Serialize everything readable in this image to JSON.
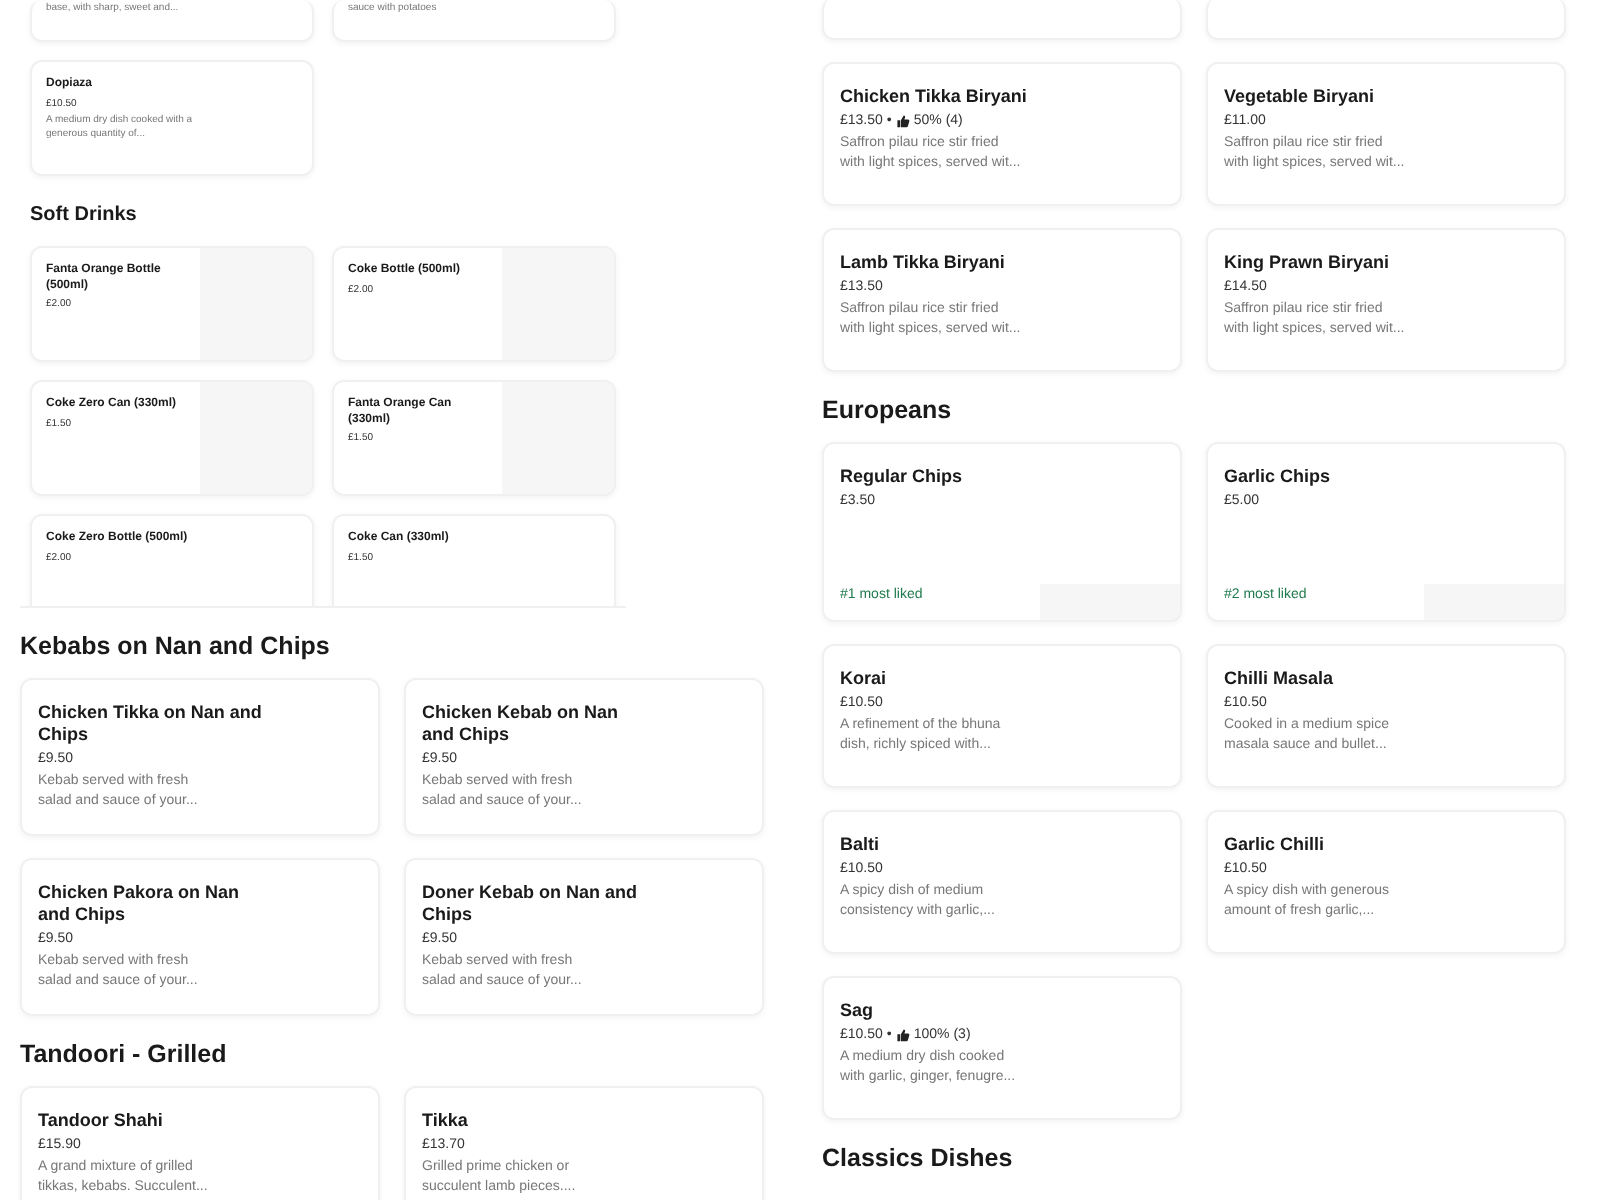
{
  "left": {
    "compact_sections": [
      {
        "items": [
          {
            "kind": "partial",
            "description": "base, with sharp, sweet and..."
          },
          {
            "kind": "partial",
            "description": "sauce with potatoes"
          },
          {
            "kind": "item",
            "name": "Dopiaza",
            "price": "£10.50",
            "description": "A medium dry dish cooked with a generous quantity of..."
          }
        ]
      },
      {
        "title": "Soft Drinks",
        "items": [
          {
            "kind": "item",
            "name": "Fanta Orange Bottle (500ml)",
            "price": "£2.00",
            "image": true
          },
          {
            "kind": "item",
            "name": "Coke Bottle (500ml)",
            "price": "£2.00",
            "image": true
          },
          {
            "kind": "item",
            "name": "Coke Zero Can (330ml)",
            "price": "£1.50",
            "image": true
          },
          {
            "kind": "item",
            "name": "Fanta Orange Can (330ml)",
            "price": "£1.50",
            "image": true
          },
          {
            "kind": "item",
            "name": "Coke Zero Bottle (500ml)",
            "price": "£2.00"
          },
          {
            "kind": "item",
            "name": "Coke Can (330ml)",
            "price": "£1.50"
          }
        ]
      }
    ],
    "sections": [
      {
        "title": "Kebabs on Nan and Chips",
        "items": [
          {
            "kind": "item",
            "name": "Chicken Tikka on Nan and Chips",
            "price": "£9.50",
            "description": "Kebab served with fresh salad and sauce of your..."
          },
          {
            "kind": "item",
            "name": "Chicken Kebab on Nan and Chips",
            "price": "£9.50",
            "description": "Kebab served with fresh salad and sauce of your..."
          },
          {
            "kind": "item",
            "name": "Chicken Pakora on Nan and Chips",
            "price": "£9.50",
            "description": "Kebab served with fresh salad and sauce of your..."
          },
          {
            "kind": "item",
            "name": "Doner Kebab on Nan and Chips",
            "price": "£9.50",
            "description": "Kebab served with fresh salad and sauce of your..."
          }
        ]
      },
      {
        "title": "Tandoori - Grilled",
        "items": [
          {
            "kind": "item",
            "name": "Tandoor Shahi",
            "price": "£15.90",
            "description": "A grand mixture of grilled tikkas, kebabs. Succulent..."
          },
          {
            "kind": "item",
            "name": "Tikka",
            "price": "£13.70",
            "description": "Grilled prime chicken or succulent lamb pieces...."
          }
        ]
      }
    ]
  },
  "right": {
    "sections": [
      {
        "items": [
          {
            "kind": "partial"
          },
          {
            "kind": "partial"
          },
          {
            "kind": "item",
            "name": "Chicken Tikka Biryani",
            "price": "£13.50",
            "separator": "•",
            "rating": "50% (4)",
            "description": "Saffron pilau rice stir fried with light spices, served wit..."
          },
          {
            "kind": "item",
            "name": "Vegetable Biryani",
            "price": "£11.00",
            "description": "Saffron pilau rice stir fried with light spices, served wit..."
          },
          {
            "kind": "item",
            "name": "Lamb Tikka Biryani",
            "price": "£13.50",
            "description": "Saffron pilau rice stir fried with light spices, served wit..."
          },
          {
            "kind": "item",
            "name": "King Prawn Biryani",
            "price": "£14.50",
            "description": "Saffron pilau rice stir fried with light spices, served wit..."
          }
        ]
      },
      {
        "title": "Europeans",
        "items": [
          {
            "kind": "item",
            "name": "Regular Chips",
            "price": "£3.50",
            "badge": "#1 most liked",
            "image": true
          },
          {
            "kind": "item",
            "name": "Garlic Chips",
            "price": "£5.00",
            "badge": "#2 most liked",
            "image": true
          },
          {
            "kind": "item",
            "name": "Korai",
            "price": "£10.50",
            "description": "A refinement of the bhuna dish, richly spiced with..."
          },
          {
            "kind": "item",
            "name": "Chilli Masala",
            "price": "£10.50",
            "description": "Cooked in a medium spice masala sauce and bullet..."
          },
          {
            "kind": "item",
            "name": "Balti",
            "price": "£10.50",
            "description": "A spicy dish of medium consistency with garlic,..."
          },
          {
            "kind": "item",
            "name": "Garlic Chilli",
            "price": "£10.50",
            "description": "A spicy dish with generous amount of fresh garlic,..."
          },
          {
            "kind": "item",
            "name": "Sag",
            "price": "£10.50",
            "separator": "•",
            "rating": "100% (3)",
            "description": "A medium dry dish cooked with garlic, ginger, fenugre..."
          }
        ]
      },
      {
        "title": "Classics Dishes"
      }
    ]
  }
}
